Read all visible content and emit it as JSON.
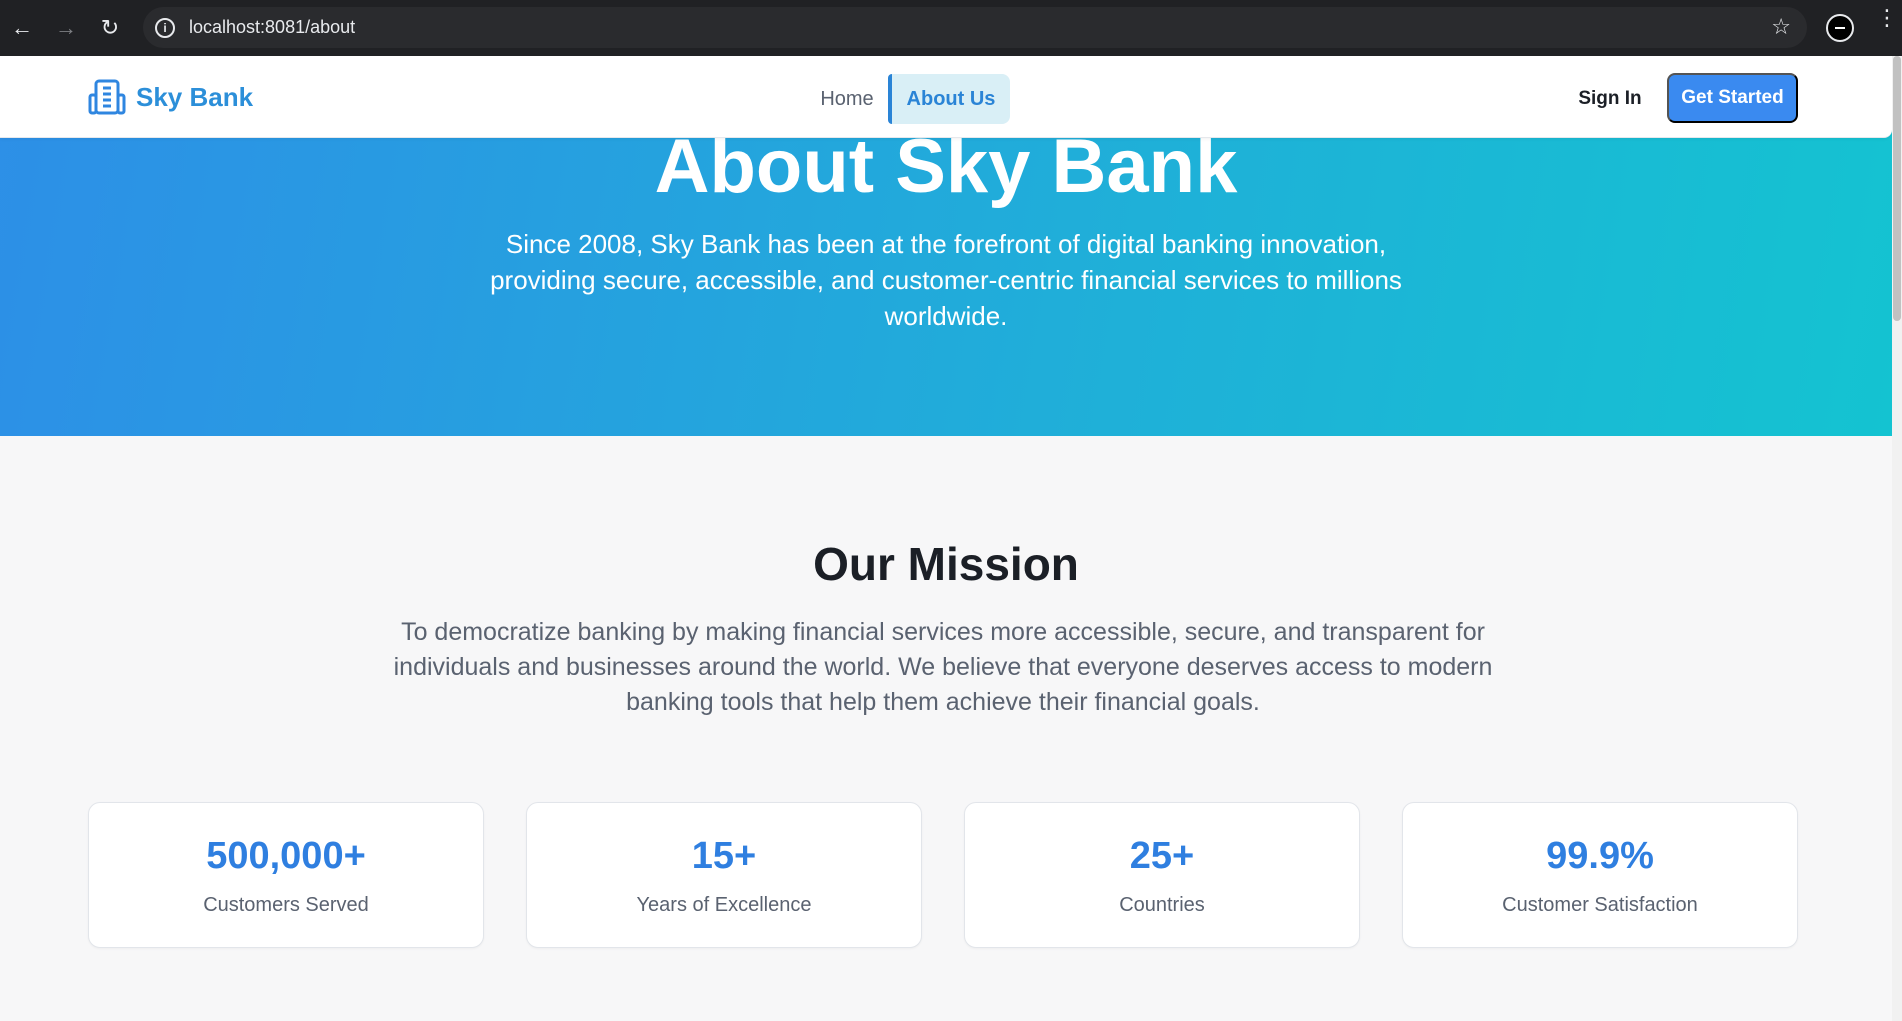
{
  "browser": {
    "url": "localhost:8081/about",
    "back_icon": "arrow-left-icon",
    "forward_icon": "arrow-right-icon",
    "reload_icon": "reload-icon"
  },
  "header": {
    "brand": "Sky Bank",
    "nav": {
      "home": "Home",
      "about": "About Us"
    },
    "sign_in": "Sign In",
    "get_started": "Get Started",
    "accent_color": "#3a8af0"
  },
  "hero": {
    "title": "About Sky Bank",
    "subtitle": "Since 2008, Sky Bank has been at the forefront of digital banking innovation, providing secure, accessible, and customer-centric financial services to millions worldwide."
  },
  "mission": {
    "title": "Our Mission",
    "text": "To democratize banking by making financial services more accessible, secure, and transparent for individuals and businesses around the world. We believe that everyone deserves access to modern banking tools that help them achieve their financial goals."
  },
  "stats": [
    {
      "value": "500,000+",
      "label": "Customers Served"
    },
    {
      "value": "15+",
      "label": "Years of Excellence"
    },
    {
      "value": "25+",
      "label": "Countries"
    },
    {
      "value": "99.9%",
      "label": "Customer Satisfaction"
    }
  ]
}
